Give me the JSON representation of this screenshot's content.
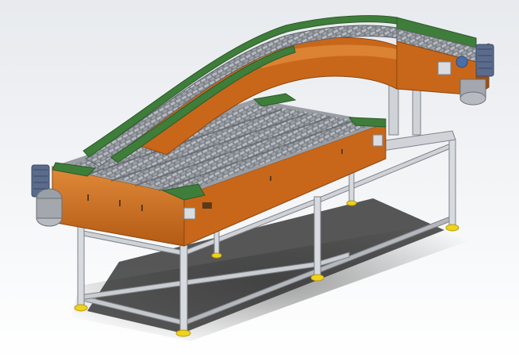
{
  "scene": {
    "subject": "conveyor-rendering",
    "colors": {
      "background_top": "#e7eaee",
      "background_bottom": "#ffffff",
      "side_panel": "#c8671a",
      "side_panel_dark": "#9e4f12",
      "side_panel_light": "#e08a3a",
      "guide_rail": "#3f7d3a",
      "guide_rail_dark": "#2c5a29",
      "chain": "#8e9299",
      "chain_dark": "#5d6168",
      "frame": "#c4c8cd",
      "frame_dark": "#8c9096",
      "foot": "#f0d21c",
      "motor": "#5a6b8c",
      "motor_dark": "#3c4a66",
      "shadow": "#3a3a3a"
    }
  }
}
